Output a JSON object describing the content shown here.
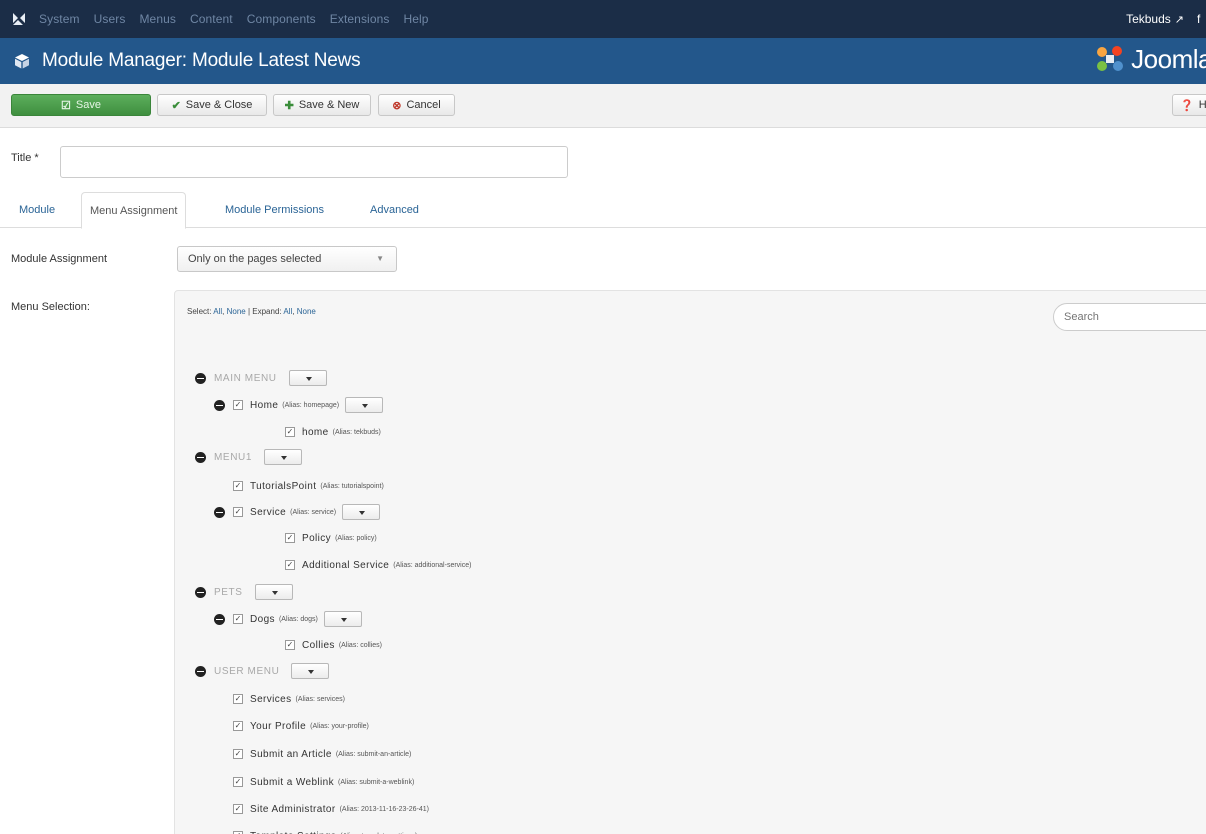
{
  "topnav": {
    "items": [
      "System",
      "Users",
      "Menus",
      "Content",
      "Components",
      "Extensions",
      "Help"
    ],
    "user": "Tekbuds",
    "user_trunc": "f"
  },
  "header": {
    "title": "Module Manager: Module Latest News",
    "brand": "Joomla"
  },
  "toolbar": {
    "save": "Save",
    "save_close": "Save & Close",
    "save_new": "Save & New",
    "cancel": "Cancel",
    "help": "H"
  },
  "title_field": {
    "label": "Title *",
    "value": ""
  },
  "tabs": [
    "Module",
    "Menu Assignment",
    "Module Permissions",
    "Advanced"
  ],
  "module_assignment": {
    "label": "Module Assignment",
    "selected": "Only on the pages selected"
  },
  "menu_selection": {
    "label": "Menu Selection:",
    "select_prefix": "Select:",
    "select_all": "All",
    "select_none": "None",
    "separator": "|",
    "expand_prefix": "Expand:",
    "expand_all": "All",
    "expand_none": "None",
    "search_placeholder": "Search",
    "tree": [
      {
        "type": "menu",
        "title": "MAIN MENU"
      },
      {
        "type": "item",
        "level": 1,
        "label": "Home",
        "alias": "(Alias: homepage)",
        "toggle": true,
        "dropdown": true
      },
      {
        "type": "item",
        "level": 2,
        "label": "home",
        "alias": "(Alias: tekbuds)"
      },
      {
        "type": "menu",
        "title": "MENU1"
      },
      {
        "type": "item",
        "level": 1,
        "label": "TutorialsPoint",
        "alias": "(Alias: tutorialspoint)"
      },
      {
        "type": "item",
        "level": 1,
        "label": "Service",
        "alias": "(Alias: service)",
        "toggle": true,
        "dropdown": true
      },
      {
        "type": "item",
        "level": 2,
        "label": "Policy",
        "alias": "(Alias: policy)"
      },
      {
        "type": "item",
        "level": 2,
        "label": "Additional Service",
        "alias": "(Alias: additional-service)"
      },
      {
        "type": "menu",
        "title": "PETS"
      },
      {
        "type": "item",
        "level": 1,
        "label": "Dogs",
        "alias": "(Alias: dogs)",
        "toggle": true,
        "dropdown": true
      },
      {
        "type": "item",
        "level": 2,
        "label": "Collies",
        "alias": "(Alias: collies)"
      },
      {
        "type": "menu",
        "title": "USER MENU"
      },
      {
        "type": "item",
        "level": 1,
        "label": "Services",
        "alias": "(Alias: services)"
      },
      {
        "type": "item",
        "level": 1,
        "label": "Your Profile",
        "alias": "(Alias: your-profile)"
      },
      {
        "type": "item",
        "level": 1,
        "label": "Submit an Article",
        "alias": "(Alias: submit-an-article)"
      },
      {
        "type": "item",
        "level": 1,
        "label": "Submit a Weblink",
        "alias": "(Alias: submit-a-weblink)"
      },
      {
        "type": "item",
        "level": 1,
        "label": "Site Administrator",
        "alias": "(Alias: 2013-11-16-23-26-41)"
      },
      {
        "type": "item",
        "level": 1,
        "label": "Template Settings",
        "alias": "(Alias: template-settings)"
      }
    ]
  },
  "colors": {
    "topnav_bg": "#1b2d47",
    "header_bg": "#23578b",
    "save_green": "#4a9e4a",
    "link_blue": "#2a6496"
  }
}
